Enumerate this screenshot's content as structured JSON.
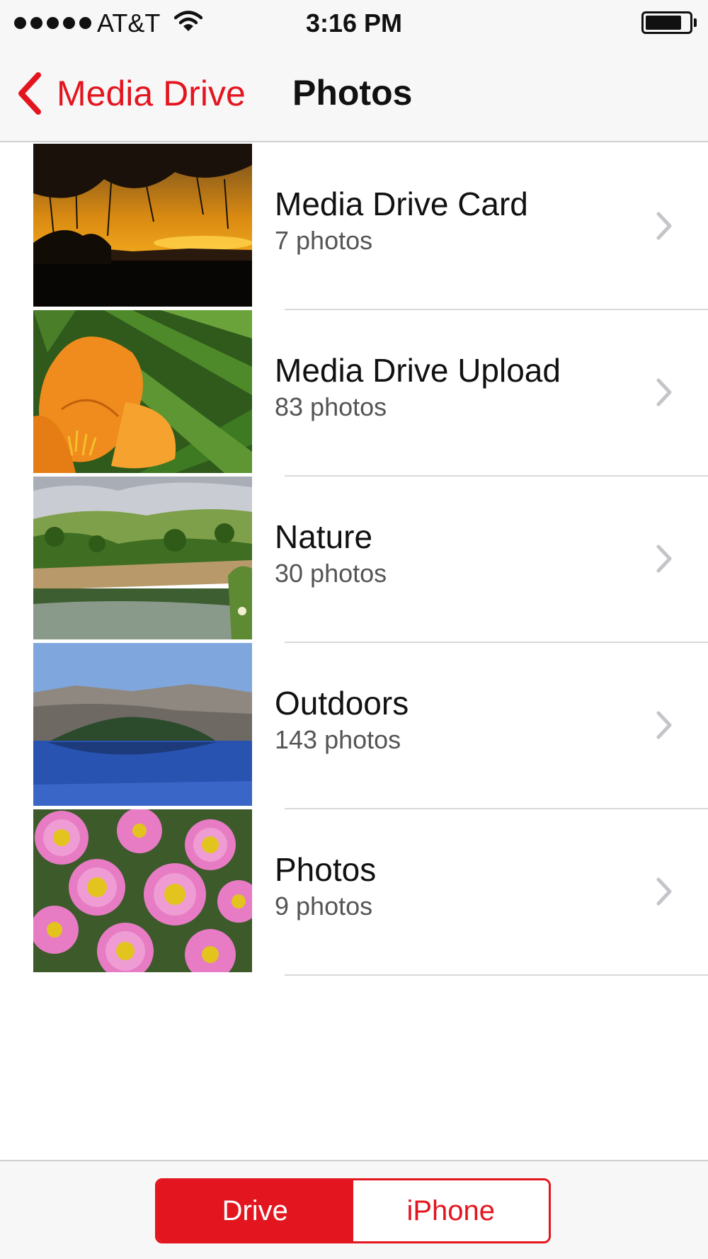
{
  "status_bar": {
    "carrier": "AT&T",
    "time": "3:16 PM",
    "signal_icon": "signal-dots-icon",
    "wifi_icon": "wifi-icon",
    "battery_icon": "battery-icon",
    "battery_level": 0.84
  },
  "nav": {
    "back_label": "Media Drive",
    "title": "Photos",
    "accent_color": "#e3151f"
  },
  "albums": [
    {
      "title": "Media Drive Card",
      "count": "7 photos"
    },
    {
      "title": "Media Drive Upload",
      "count": "83 photos"
    },
    {
      "title": "Nature",
      "count": "30 photos"
    },
    {
      "title": "Outdoors",
      "count": "143 photos"
    },
    {
      "title": "Photos",
      "count": "9 photos"
    }
  ],
  "toolbar": {
    "segments": [
      {
        "label": "Drive",
        "selected": true
      },
      {
        "label": "iPhone",
        "selected": false
      }
    ]
  }
}
